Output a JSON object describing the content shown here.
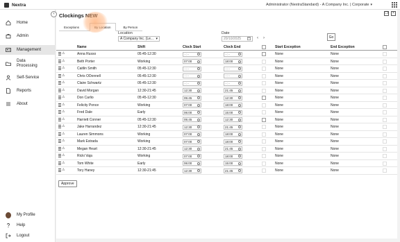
{
  "app": {
    "name": "Nextra"
  },
  "topbar": {
    "user": "Administrator (NextraStandard) - A Company Inc. | Corporate"
  },
  "sidebar": {
    "items": [
      {
        "label": "Home",
        "icon": "home-icon"
      },
      {
        "label": "Admin",
        "icon": "briefcase-icon"
      },
      {
        "label": "Management",
        "icon": "id-card-icon",
        "active": true
      },
      {
        "label": "Data Processing",
        "icon": "folder-icon"
      },
      {
        "label": "Self-Service",
        "icon": "person-icon"
      },
      {
        "label": "Reports",
        "icon": "document-icon"
      },
      {
        "label": "About",
        "icon": "info-icon"
      }
    ],
    "bottom": [
      {
        "label": "My Profile",
        "icon": "avatar"
      },
      {
        "label": "Help",
        "icon": "help-icon"
      },
      {
        "label": "Logout",
        "icon": "logout-icon"
      }
    ]
  },
  "page": {
    "title": "Clockings NEW"
  },
  "tabs": [
    {
      "label": "Exceptions"
    },
    {
      "label": "By Location",
      "active": true
    },
    {
      "label": "By Person"
    }
  ],
  "filters": {
    "location_label": "Location",
    "location_value": "A Company Inc. (Le...",
    "date_label": "Date",
    "date_value": "20/10/2025",
    "go_label": "Go"
  },
  "table": {
    "headers": {
      "name": "Name",
      "shift": "Shift",
      "clock_start": "Clock Start",
      "clock_end": "Clock End",
      "start_exception": "Start Exception",
      "end_exception": "End Exception"
    },
    "rows": [
      {
        "name": "Anna Russo",
        "shift": "05:45-12:30",
        "start": "--:--",
        "end": "--:--",
        "start_exc": "None",
        "end_exc": "None"
      },
      {
        "name": "Beth Porter",
        "shift": "Working",
        "start": "07:00",
        "end": "18:00",
        "start_exc": "None",
        "end_exc": "None"
      },
      {
        "name": "Caitlin Smith",
        "shift": "05:45-12:30",
        "start": "--:--",
        "end": "--:--",
        "start_exc": "None",
        "end_exc": "None"
      },
      {
        "name": "Chris ODonnell",
        "shift": "05:45-12:30",
        "start": "--:--",
        "end": "--:--",
        "start_exc": "None",
        "end_exc": "None"
      },
      {
        "name": "Claire Schwartz",
        "shift": "05:45-12:30",
        "start": "--:--",
        "end": "--:--",
        "start_exc": "None",
        "end_exc": "None"
      },
      {
        "name": "David Morgan",
        "shift": "12:30-21:45",
        "start": "12:30",
        "end": "21:45",
        "start_exc": "None",
        "end_exc": "None"
      },
      {
        "name": "Don Carlio",
        "shift": "05:45-12:30",
        "start": "05:45",
        "end": "12:30",
        "start_exc": "None",
        "end_exc": "None"
      },
      {
        "name": "Felicity Ponce",
        "shift": "Working",
        "start": "07:00",
        "end": "18:00",
        "start_exc": "None",
        "end_exc": "None"
      },
      {
        "name": "Fred Dale",
        "shift": "Early",
        "start": "06:00",
        "end": "15:00",
        "start_exc": "None",
        "end_exc": "None"
      },
      {
        "name": "Harriett Conner",
        "shift": "05:45-12:30",
        "start": "05:45",
        "end": "12:30",
        "start_exc": "None",
        "end_exc": "None"
      },
      {
        "name": "Jake Harrandez",
        "shift": "12:30-21:45",
        "start": "12:30",
        "end": "21:45",
        "start_exc": "None",
        "end_exc": "None"
      },
      {
        "name": "Lauren Simmons",
        "shift": "Working",
        "start": "07:00",
        "end": "18:00",
        "start_exc": "None",
        "end_exc": "None"
      },
      {
        "name": "Mark Estrada",
        "shift": "Working",
        "start": "07:00",
        "end": "18:00",
        "start_exc": "None",
        "end_exc": "None"
      },
      {
        "name": "Megan Heart",
        "shift": "12:30-21:45",
        "start": "12:30",
        "end": "21:45",
        "start_exc": "None",
        "end_exc": "None"
      },
      {
        "name": "Ricki Vaja",
        "shift": "Working",
        "start": "07:00",
        "end": "18:00",
        "start_exc": "None",
        "end_exc": "None"
      },
      {
        "name": "Tom White",
        "shift": "Early",
        "start": "06:00",
        "end": "15:00",
        "start_exc": "None",
        "end_exc": "None"
      },
      {
        "name": "Tory Haney",
        "shift": "12:30-21:45",
        "start": "12:30",
        "end": "21:45",
        "start_exc": "None",
        "end_exc": "None"
      }
    ]
  },
  "actions": {
    "approve_label": "Approve"
  },
  "colors": {
    "highlight": "#ffaa6e",
    "active_nav": "#e6e6e6"
  }
}
